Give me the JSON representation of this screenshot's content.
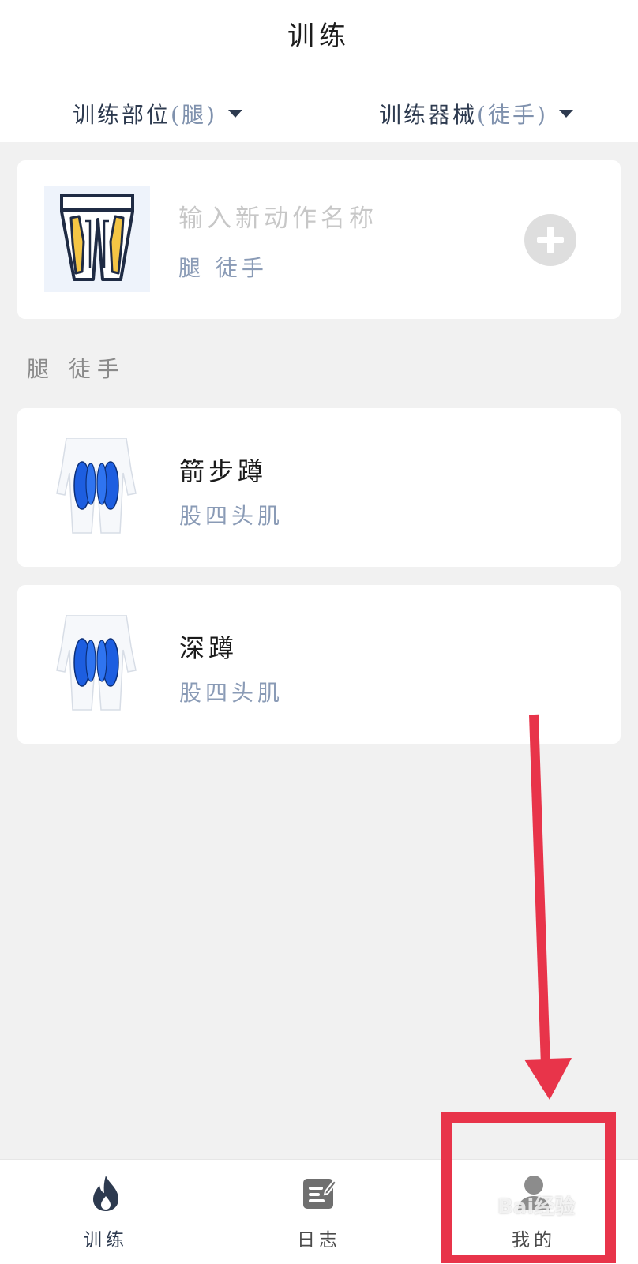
{
  "header": {
    "title": "训练",
    "filter_part": {
      "label": "训练部位",
      "value": "(腿)"
    },
    "filter_equipment": {
      "label": "训练器械",
      "value": "(徒手)"
    }
  },
  "new_action": {
    "name_placeholder": "输入新动作名称",
    "tags": "腿 徒手",
    "add_icon": "plus-icon"
  },
  "section": {
    "label": "腿 徒手"
  },
  "exercises": [
    {
      "name": "箭步蹲",
      "muscle": "股四头肌"
    },
    {
      "name": "深蹲",
      "muscle": "股四头肌"
    }
  ],
  "tabbar": {
    "items": [
      {
        "label": "训练",
        "icon": "flame-icon",
        "active": true
      },
      {
        "label": "日志",
        "icon": "notepad-icon",
        "active": false
      },
      {
        "label": "我的",
        "icon": "person-icon",
        "active": false
      }
    ]
  },
  "watermark": "Bai经验",
  "colors": {
    "accent": "#2d3a4f",
    "muted_blue": "#8a9bb6",
    "annotation_red": "#e8344a",
    "muscle_blue": "#1d5ee0"
  }
}
